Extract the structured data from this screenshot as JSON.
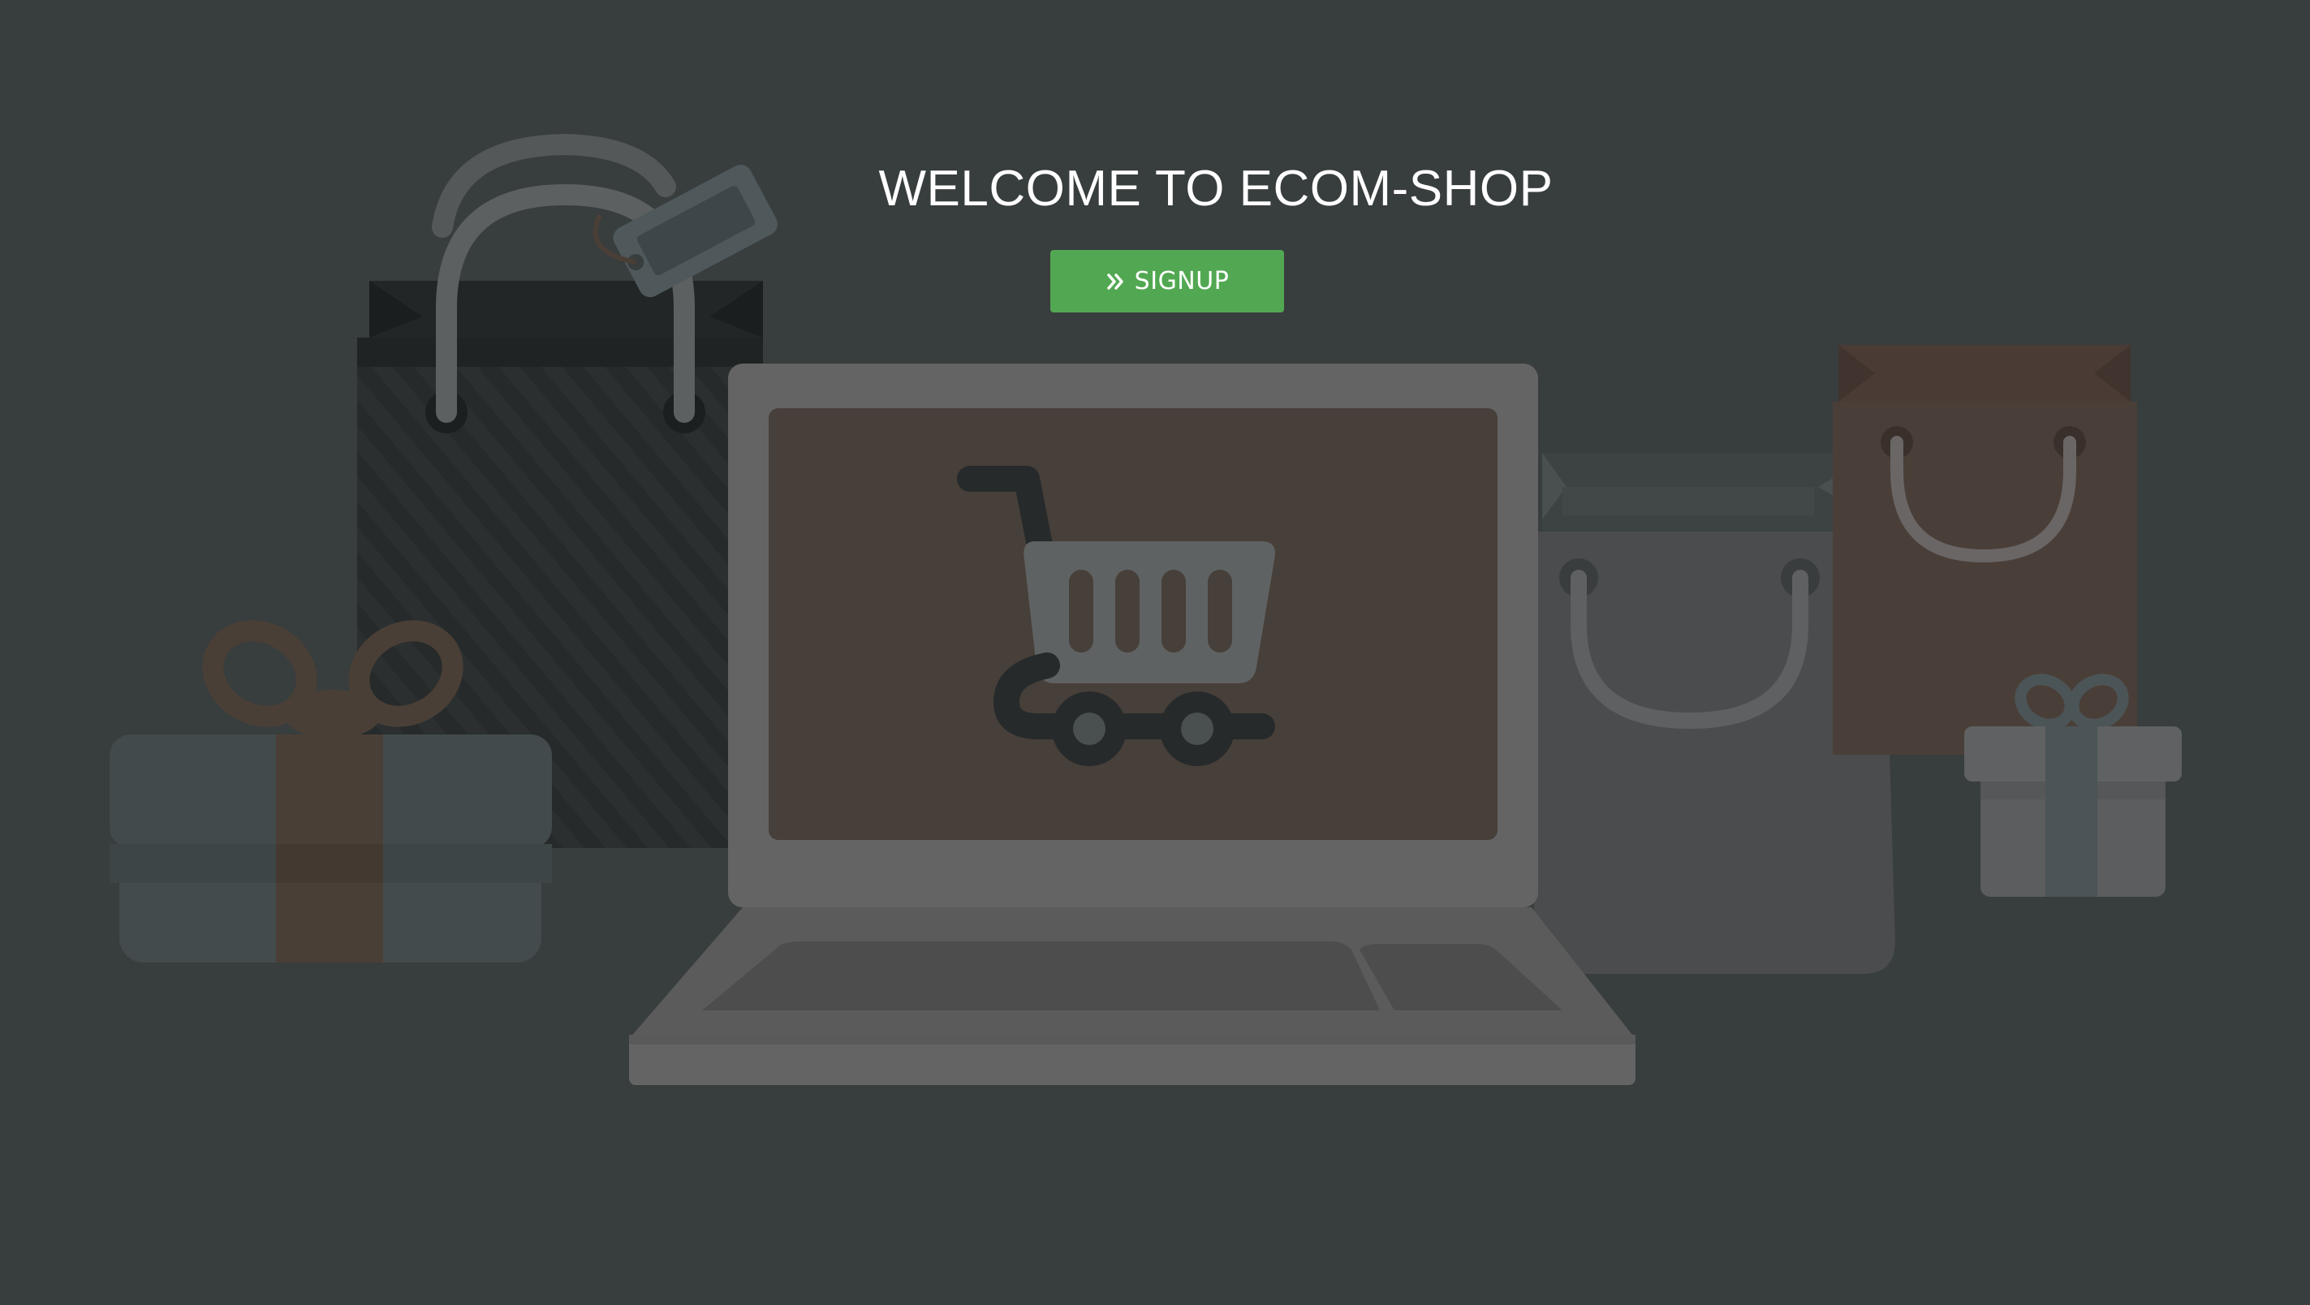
{
  "page": {
    "title": "WELCOME TO ECOM-SHOP"
  },
  "signup": {
    "label": "SIGNUP",
    "icon": "double-chevron-right-icon",
    "color": "#52a852"
  },
  "theme": {
    "background": "#383d3e",
    "accent": "#52a852",
    "text": "#ffffff"
  },
  "illustration": {
    "items": [
      "shopping-bag-icon",
      "price-tag-icon",
      "gift-box-icon",
      "laptop-icon",
      "shopping-cart-icon"
    ]
  }
}
